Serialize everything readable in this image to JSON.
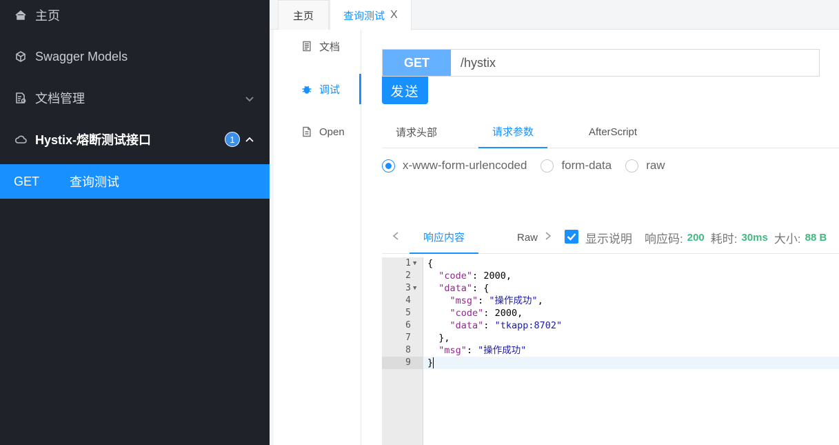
{
  "sidebar": {
    "items": [
      {
        "label": "主页",
        "icon": "home-icon"
      },
      {
        "label": "Swagger Models",
        "icon": "cube-icon"
      },
      {
        "label": "文档管理",
        "icon": "doc-settings-icon"
      },
      {
        "label": "Hystix-熔断测试接口",
        "icon": "cloud-icon",
        "badge": "1"
      }
    ],
    "active_sub": {
      "method": "GET",
      "label": "查询测试"
    }
  },
  "top_tabs": {
    "home": "主页",
    "active": "查询测试",
    "close": "X"
  },
  "side_nav": [
    {
      "label": "文档",
      "icon": "document-icon"
    },
    {
      "label": "调试",
      "icon": "bug-icon"
    },
    {
      "label": "Open",
      "icon": "file-icon"
    }
  ],
  "request": {
    "method": "GET",
    "url": "/hystix",
    "send_label": "发送",
    "tabs": [
      "请求头部",
      "请求参数",
      "AfterScript"
    ],
    "content_types": [
      "x-www-form-urlencoded",
      "form-data",
      "raw"
    ]
  },
  "response": {
    "tab_content": "响应内容",
    "tab_raw": "Raw",
    "show_desc": "显示说明",
    "code_label": "响应码:",
    "code_value": "200",
    "time_label": "耗时:",
    "time_value": "30ms",
    "size_label": "大小:",
    "size_value": "88 B"
  },
  "colors": {
    "accent": "#1890ff",
    "sidebar_bg": "#1f2329",
    "success": "#42b983"
  },
  "json_body": {
    "code_key": "\"code\"",
    "code_val": "2000",
    "data_key": "\"data\"",
    "msg_key": "\"msg\"",
    "msg_val": "\"操作成功\"",
    "inner_data_val": "\"tkapp:8702\""
  },
  "line_numbers": [
    "1",
    "2",
    "3",
    "4",
    "5",
    "6",
    "7",
    "8",
    "9"
  ]
}
